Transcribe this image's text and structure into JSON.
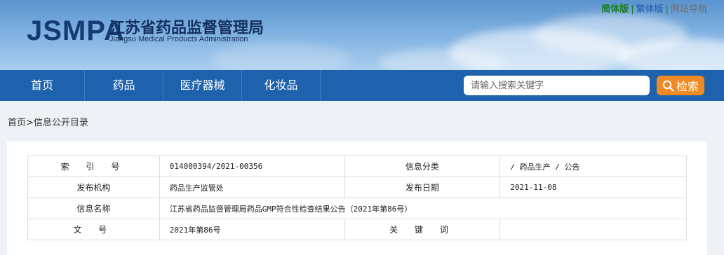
{
  "header": {
    "logo_abbr": "JSMPA",
    "title_cn": "江苏省药品监督管理局",
    "title_en": "Jiangsu Medical Products Administration",
    "lang_links": {
      "simplified": "简体版",
      "traditional": "繁体版",
      "site_nav": "网站导航",
      "separator": "|"
    }
  },
  "nav": {
    "items": [
      "首页",
      "药品",
      "医疗器械",
      "化妆品"
    ]
  },
  "search": {
    "placeholder": "请输入搜索关键字",
    "button_label": "检索"
  },
  "breadcrumb": {
    "home": "首页",
    "sep": ">",
    "current": "信息公开目录"
  },
  "info_table": {
    "index_label": "索 引 号",
    "index_value": "014000394/2021-00356",
    "category_label": "信息分类",
    "category_value": "/  药品生产  /  公告",
    "publisher_label": "发布机构",
    "publisher_value": "药品生产监管处",
    "date_label": "发布日期",
    "date_value": "2021-11-08",
    "name_label": "信息名称",
    "name_value": "江苏省药品监督管理局药品GMP符合性检查结果公告（2021年第86号）",
    "docno_label": "文 号",
    "docno_value": "2021年第86号",
    "keywords_label": "关 键 词",
    "keywords_value": ""
  },
  "colors": {
    "nav_bg": "#1e62ad",
    "search_btn": "#f08a24",
    "header_sky": "#7db0e0"
  }
}
